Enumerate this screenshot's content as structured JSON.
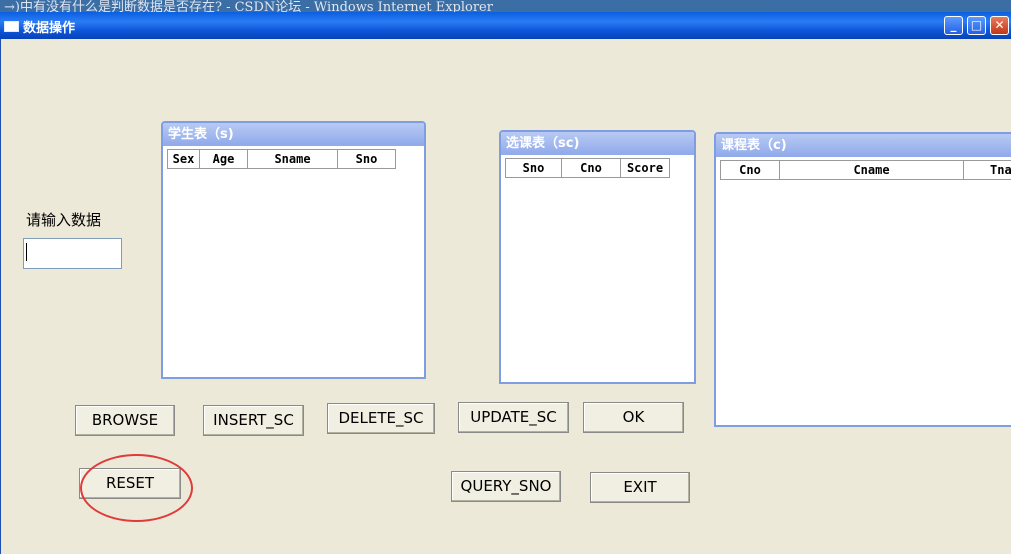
{
  "background_title": "→)中有没有什么是判断数据是否存在? - CSDN论坛 - Windows Internet Explorer",
  "window": {
    "title": "数据操作",
    "minimize": "_",
    "maximize": "□",
    "close": "✕"
  },
  "input_label": "请输入数据",
  "input_value": "",
  "tables": {
    "student": {
      "title": "学生表（s)",
      "columns": [
        "Sex",
        "Age",
        "Sname",
        "Sno"
      ]
    },
    "course_selection": {
      "title": "选课表（sc)",
      "columns": [
        "Sno",
        "Cno",
        "Score"
      ]
    },
    "course": {
      "title": "课程表（c)",
      "columns": [
        "Cno",
        "Cname",
        "Tna"
      ]
    }
  },
  "buttons": {
    "browse": "BROWSE",
    "insert_sc": "INSERT_SC",
    "delete_sc": "DELETE_SC",
    "update_sc": "UPDATE_SC",
    "ok": "OK",
    "reset": "RESET",
    "query_sno": "QUERY_SNO",
    "exit": "EXIT"
  },
  "colors": {
    "titlebar": "#0a5fe0",
    "panel_title": "#8fa9ea",
    "window_bg": "#ece9d8",
    "highlight_ring": "#e03a3a"
  }
}
